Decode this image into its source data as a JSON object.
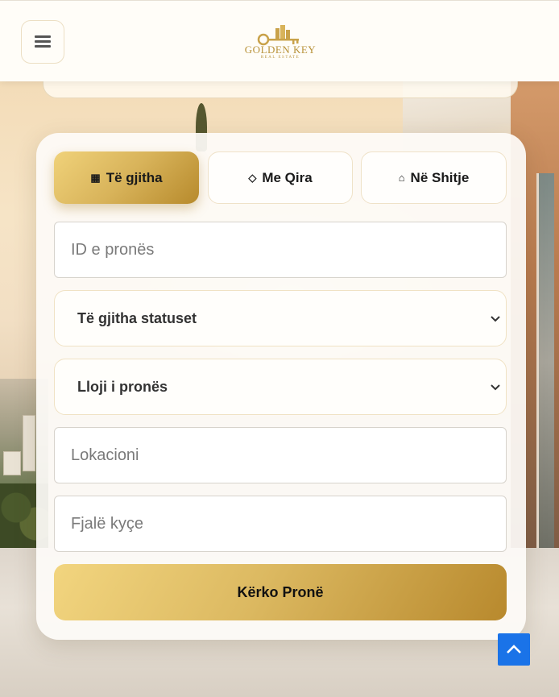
{
  "header": {
    "menu_icon": "hamburger-menu-icon",
    "logo": {
      "brand": "GOLDEN KEY",
      "tagline": "REAL ESTATE",
      "accent_color": "#b8923a"
    }
  },
  "search": {
    "tabs": [
      {
        "glyph": "▦",
        "label": "Të gjitha",
        "icon": "grid-icon",
        "active": true
      },
      {
        "glyph": "◇",
        "label": "Me Qira",
        "icon": "diamond-icon",
        "active": false
      },
      {
        "glyph": "⌂",
        "label": "Në Shitje",
        "icon": "house-icon",
        "active": false
      }
    ],
    "property_id_placeholder": "ID e pronës",
    "status_select_value": "Të gjitha statuset",
    "type_select_value": "Lloji i pronës",
    "location_placeholder": "Lokacioni",
    "keywords_placeholder": "Fjalë kyçe",
    "submit_label": "Kërko Pronë"
  },
  "colors": {
    "gold_light": "#f0d27a",
    "gold_dark": "#b78a2c",
    "scroll_top_button": "#1a73e8"
  },
  "scroll_top_icon": "chevron-up-icon"
}
